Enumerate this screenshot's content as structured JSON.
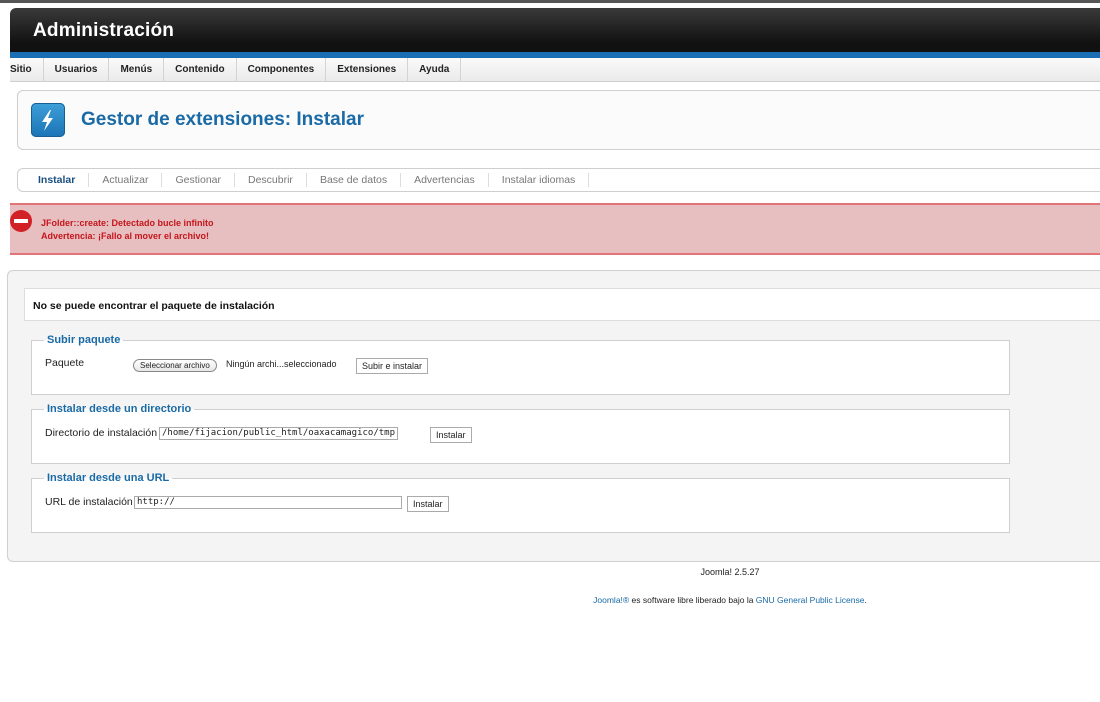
{
  "header": {
    "title": "Administración"
  },
  "menu": {
    "items": [
      "Sitio",
      "Usuarios",
      "Menús",
      "Contenido",
      "Componentes",
      "Extensiones",
      "Ayuda"
    ]
  },
  "toolbar": {
    "page_title": "Gestor de extensiones: Instalar",
    "icon": "extension-lightning-icon"
  },
  "submenu": {
    "tabs": [
      "Instalar",
      "Actualizar",
      "Gestionar",
      "Descubrir",
      "Base de datos",
      "Advertencias",
      "Instalar idiomas"
    ],
    "active": "Instalar"
  },
  "alert": {
    "icon": "stop-icon",
    "messages": [
      "JFolder::create: Detectado bucle infinito",
      "Advertencia: ¡Fallo al mover el archivo!"
    ],
    "color": "#c4161c"
  },
  "notice": {
    "text": "No se puede encontrar el paquete de instalación"
  },
  "upload": {
    "legend": "Subir paquete",
    "label": "Paquete",
    "file_button": "Seleccionar archivo",
    "file_status": "Ningún archi...seleccionado",
    "submit": "Subir e instalar"
  },
  "directory": {
    "legend": "Instalar desde un directorio",
    "label": "Directorio de instalación",
    "value": "/home/fijacion/public_html/oaxacamagico/tmp",
    "submit": "Instalar"
  },
  "url": {
    "legend": "Instalar desde una URL",
    "label": "URL de instalación",
    "value": "http://",
    "submit": "Instalar"
  },
  "footer": {
    "version": "Joomla! 2.5.27",
    "brand_link": "Joomla!®",
    "license_text": " es software libre liberado bajo la ",
    "license_link": "GNU General Public License",
    "license_end": "."
  },
  "colors": {
    "accent": "#1a6aa6",
    "header_band": "#1a6fb4",
    "alert_bg": "#e8bfc0"
  }
}
